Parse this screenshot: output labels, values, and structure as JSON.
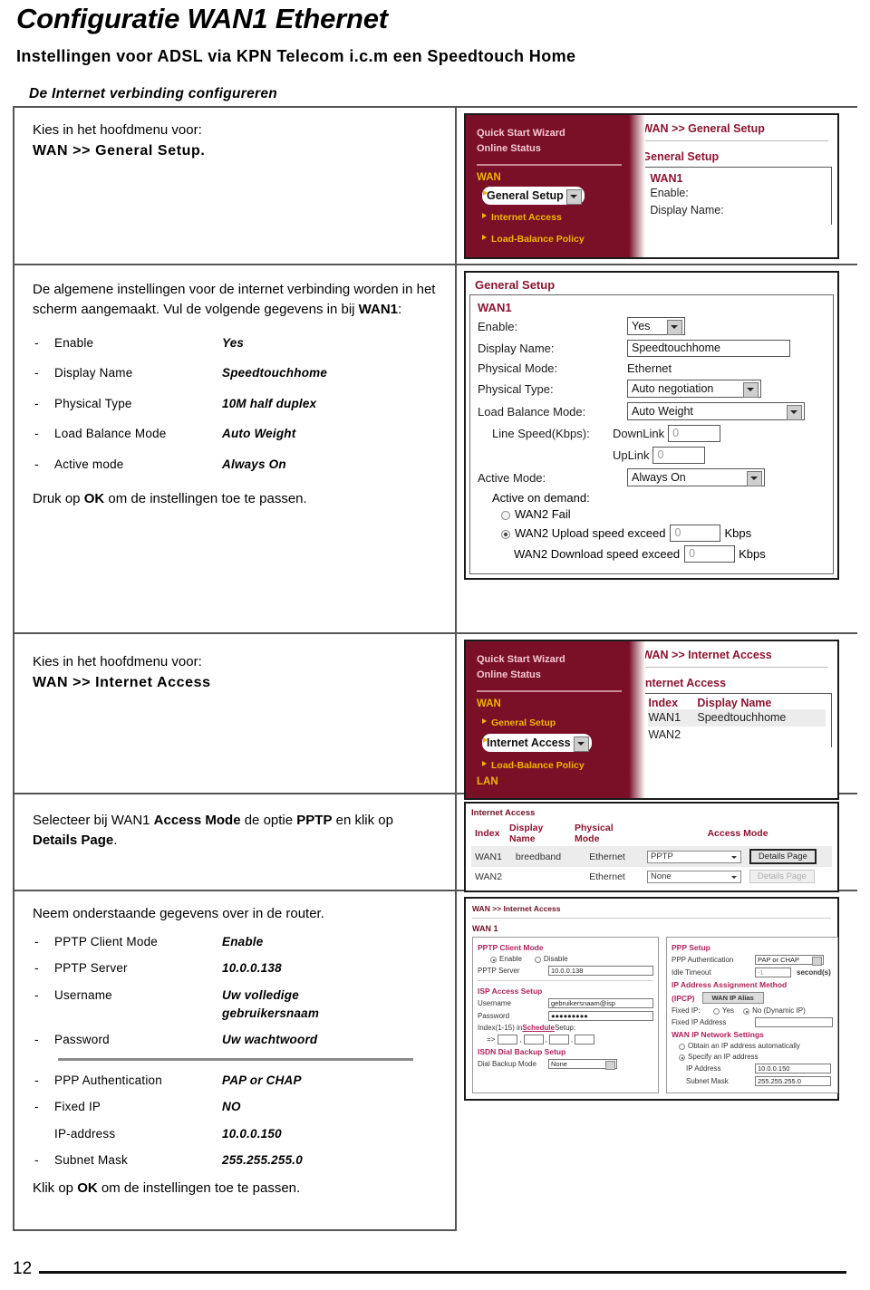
{
  "document": {
    "title": "Configuratie WAN1 Ethernet",
    "subtitle": "Instellingen voor ADSL via KPN Telecom i.c.m een Speedtouch Home",
    "section_heading": "De Internet verbinding configureren",
    "page_number": "12"
  },
  "step1": {
    "line1": "Kies in het hoofdmenu voor:",
    "line2": "WAN >> General Setup."
  },
  "step2": {
    "para": "De algemene instellingen voor de internet verbinding worden in het scherm aangemaakt. Vul de volgende gegevens in bij ",
    "para_bold": "WAN1",
    "para_end": ":",
    "items": [
      {
        "key": "Enable",
        "value": "Yes"
      },
      {
        "key": "Display Name",
        "value": "Speedtouchhome"
      },
      {
        "key": "Physical Type",
        "value": "10M half duplex"
      },
      {
        "key": "Load Balance Mode",
        "value": "Auto Weight"
      },
      {
        "key": "Active mode",
        "value": "Always On"
      }
    ],
    "footer_pre": "Druk op ",
    "footer_bold": "OK",
    "footer_post": " om de instellingen toe te passen."
  },
  "step3": {
    "line1": "Kies in het hoofdmenu voor:",
    "line2": "WAN >> Internet Access"
  },
  "step4": {
    "pre": "Selecteer bij WAN1 ",
    "bold1": "Access Mode",
    "mid": " de optie ",
    "bold2": "PPTP",
    "mid2": " en klik op ",
    "bold3": "Details Page",
    "end": "."
  },
  "step5": {
    "intro": "Neem onderstaande gegevens over in de router.",
    "items": [
      {
        "dash": "-",
        "key": "PPTP Client Mode",
        "value": "Enable"
      },
      {
        "dash": "-",
        "key": "PPTP Server",
        "value": "10.0.0.138"
      },
      {
        "dash": "-",
        "key": "Username",
        "value": "Uw volledige\ngebruikersnaam"
      },
      {
        "dash": "-",
        "key": "Password",
        "value": "Uw wachtwoord"
      }
    ],
    "items2": [
      {
        "dash": "-",
        "key": "PPP Authentication",
        "value": "PAP or CHAP"
      },
      {
        "dash": "-",
        "key": "Fixed IP",
        "value": "NO"
      },
      {
        "dash": "",
        "key": "IP-address",
        "value": "10.0.0.150"
      },
      {
        "dash": "-",
        "key": "Subnet Mask",
        "value": "255.255.255.0"
      }
    ],
    "footer_pre": "Klik op ",
    "footer_bold": "OK",
    "footer_post": " om de instellingen toe te passen."
  },
  "shot_general_nav": {
    "nav": {
      "quick_start": "Quick Start Wizard",
      "online_status": "Online Status",
      "group": "WAN",
      "items": [
        "General Setup",
        "Internet Access",
        "Load-Balance Policy"
      ],
      "selected": "General Setup"
    },
    "main": {
      "breadcrumb": "WAN >> General Setup",
      "panel_title": "General Setup",
      "wan_label": "WAN1",
      "field_enable": "Enable:",
      "field_display_name": "Display Name:"
    }
  },
  "shot_general_setup": {
    "header": "General Setup",
    "wan_label": "WAN1",
    "rows": [
      {
        "label": "Enable:",
        "type": "select",
        "value": "Yes"
      },
      {
        "label": "Display Name:",
        "type": "input",
        "value": "Speedtouchhome"
      },
      {
        "label": "Physical Mode:",
        "type": "text",
        "value": "Ethernet"
      },
      {
        "label": "Physical Type:",
        "type": "select",
        "value": "Auto negotiation"
      },
      {
        "label": "Load Balance Mode:",
        "type": "select",
        "value": "Auto Weight"
      }
    ],
    "line_speed_label": "Line Speed(Kbps):",
    "downlink_label": "DownLink",
    "downlink_value": "0",
    "uplink_label": "UpLink",
    "uplink_value": "0",
    "active_mode_label": "Active Mode:",
    "active_mode_value": "Always On",
    "active_on_demand_label": "Active on demand:",
    "wan2_fail": "WAN2 Fail",
    "wan2_upload": "WAN2 Upload speed exceed",
    "wan2_upload_value": "0",
    "wan2_download": "WAN2 Download speed exceed",
    "wan2_download_value": "0",
    "kbps": "Kbps"
  },
  "shot_internet_nav": {
    "nav": {
      "quick_start": "Quick Start Wizard",
      "online_status": "Online Status",
      "group": "WAN",
      "items": [
        "General Setup",
        "Internet Access",
        "Load-Balance Policy"
      ],
      "group2": "LAN",
      "selected": "Internet Access"
    },
    "main": {
      "breadcrumb": "WAN >> Internet Access",
      "panel_title": "Internet Access",
      "col_index": "Index",
      "col_display_name": "Display Name",
      "rows": [
        {
          "index": "WAN1",
          "display_name": "Speedtouchhome"
        },
        {
          "index": "WAN2",
          "display_name": ""
        }
      ]
    }
  },
  "shot_access_table": {
    "title": "Internet Access",
    "headers": [
      "Index",
      "Display Name",
      "Physical Mode",
      "Access Mode"
    ],
    "rows": [
      {
        "index": "WAN1",
        "display_name": "breedband",
        "physical_mode": "Ethernet",
        "access_mode": "PPTP",
        "button": "Details Page",
        "enabled": true
      },
      {
        "index": "WAN2",
        "display_name": "",
        "physical_mode": "Ethernet",
        "access_mode": "None",
        "button": "Details Page",
        "enabled": false
      }
    ]
  },
  "shot_pptp": {
    "breadcrumb": "WAN >> Internet Access",
    "wan_label": "WAN 1",
    "left": {
      "pptp_title": "PPTP Client Mode",
      "enable": "Enable",
      "disable": "Disable",
      "server_label": "PPTP Server",
      "server_value": "10.0.0.138",
      "isp_title": "ISP Access Setup",
      "username_label": "Username",
      "username_value": "gebruikersnaam@isp",
      "password_label": "Password",
      "password_value": "●●●●●●●●●",
      "index_label_pre": "Index(1-15) in ",
      "index_link": "Schedule",
      "index_label_post": " Setup:",
      "arrow": "=>",
      "isdn_title": "ISDN Dial Backup Setup",
      "dial_label": "Dial Backup Mode",
      "dial_value": "None"
    },
    "right": {
      "ppp_title": "PPP Setup",
      "ppp_auth_label": "PPP Authentication",
      "ppp_auth_value": "PAP or CHAP",
      "idle_label": "Idle Timeout",
      "idle_value": "-1",
      "seconds": "second(s)",
      "ip_method_title": "IP Address Assignment Method",
      "ipcp": "(IPCP)",
      "wan_ip_alias": "WAN IP Alias",
      "fixed_ip_label": "Fixed IP:",
      "fixed_yes": "Yes",
      "fixed_no": "No (Dynamic IP)",
      "fixed_ip_addr_label": "Fixed IP Address",
      "fixed_ip_addr_value": "",
      "net_title": "WAN IP Network Settings",
      "obtain": "Obtain an IP address automatically",
      "specify": "Specify an IP address",
      "ip_label": "IP Address",
      "ip_value": "10.0.0.150",
      "subnet_label": "Subnet Mask",
      "subnet_value": "255.255.255.0"
    }
  },
  "colors": {
    "maroon": "#7a1028",
    "crumb": "#8a1530",
    "gold": "#f0b400",
    "pink": "#b0215a"
  }
}
